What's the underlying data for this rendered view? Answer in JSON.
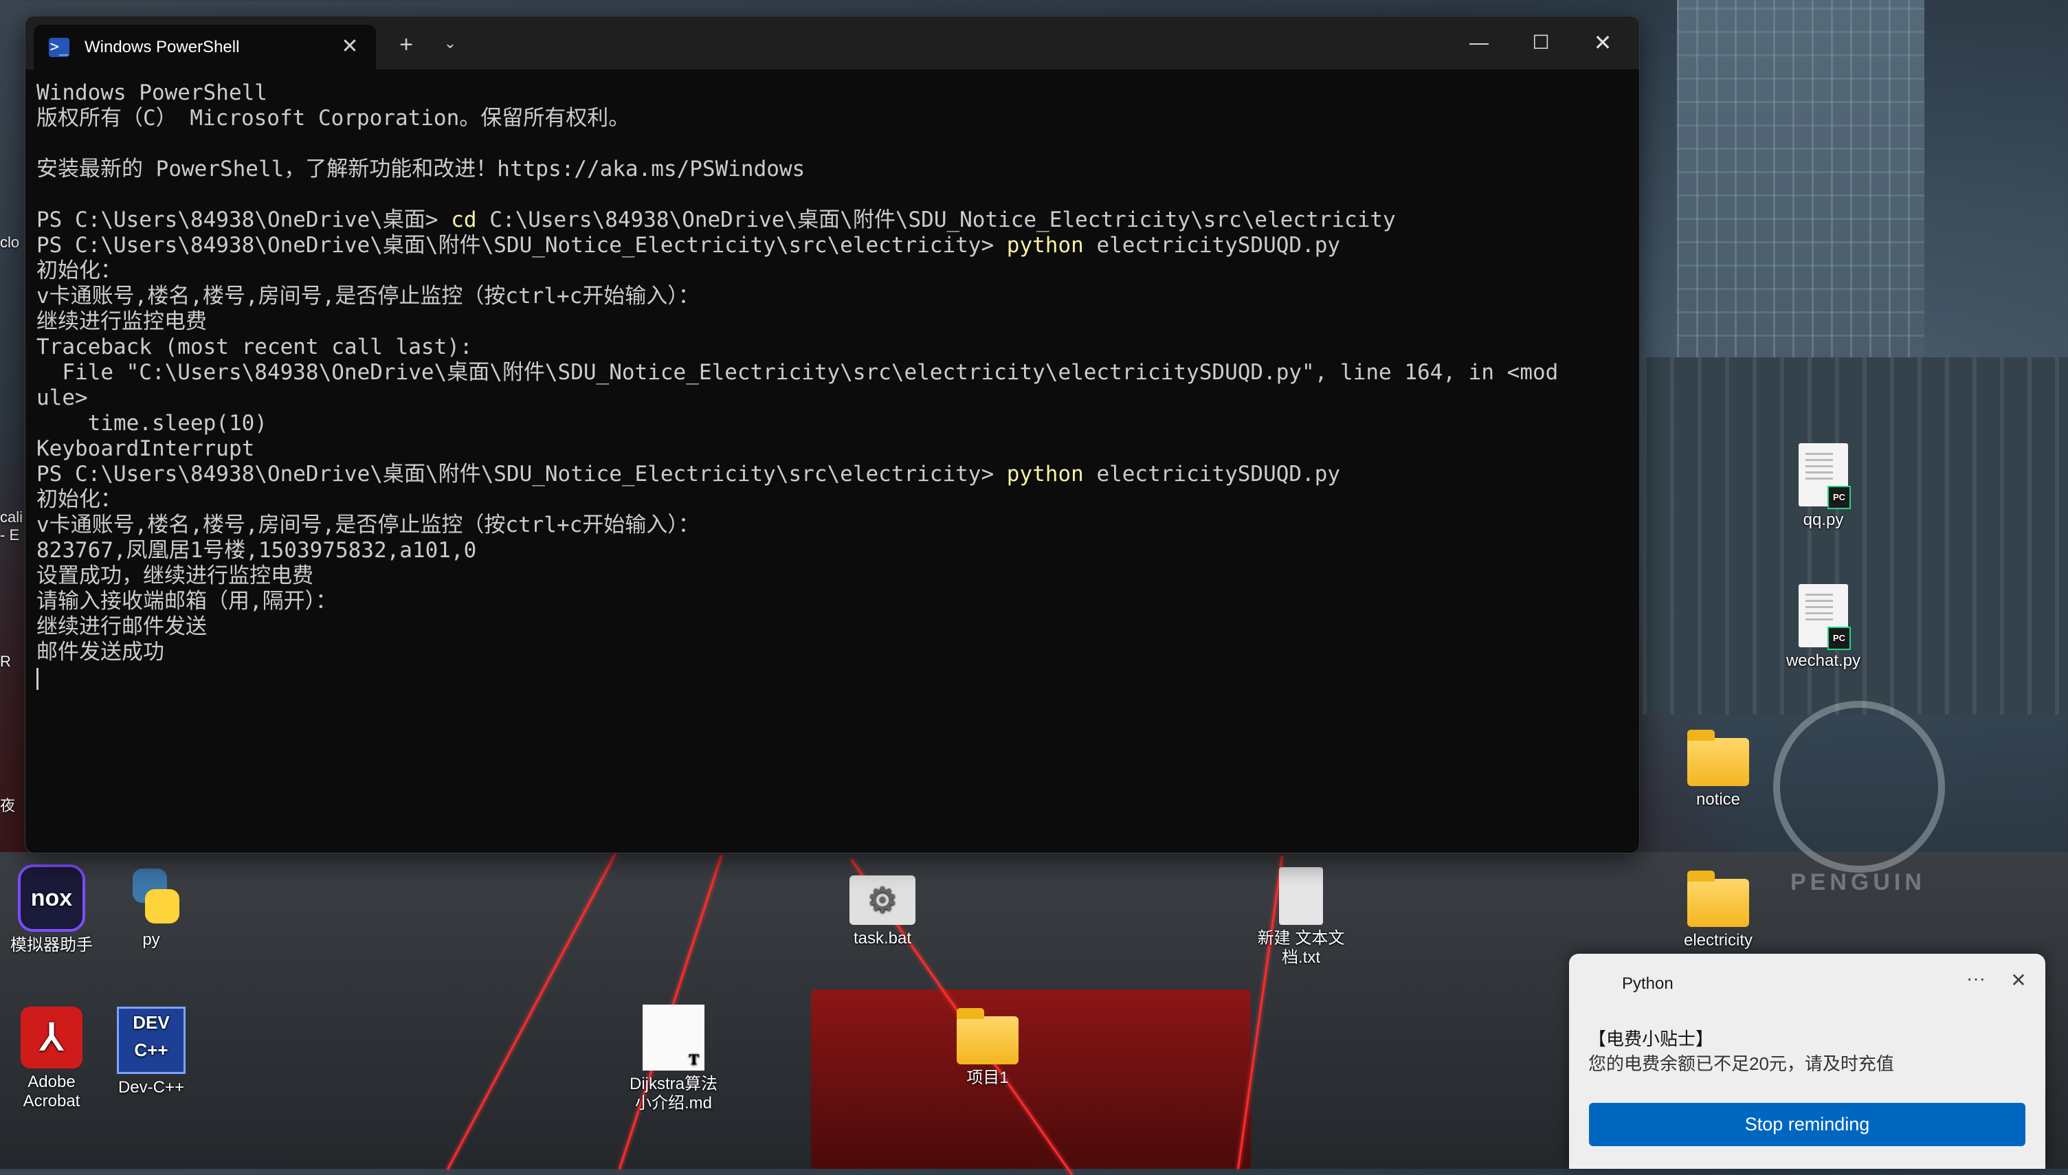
{
  "terminal": {
    "tab_title": "Windows PowerShell",
    "tab_icon": "powershell-icon",
    "lines": [
      [
        {
          "t": "Windows PowerShell"
        }
      ],
      [
        {
          "t": "版权所有（C） Microsoft Corporation。保留所有权利。"
        }
      ],
      [
        {
          "t": ""
        }
      ],
      [
        {
          "t": "安装最新的 PowerShell，了解新功能和改进！https://aka.ms/PSWindows"
        }
      ],
      [
        {
          "t": ""
        }
      ],
      [
        {
          "t": "PS C:\\Users\\84938\\OneDrive\\桌面> "
        },
        {
          "t": "cd",
          "c": "cmd"
        },
        {
          "t": " C:\\Users\\84938\\OneDrive\\桌面\\附件\\SDU_Notice_Electricity\\src\\electricity"
        }
      ],
      [
        {
          "t": "PS C:\\Users\\84938\\OneDrive\\桌面\\附件\\SDU_Notice_Electricity\\src\\electricity> "
        },
        {
          "t": "python",
          "c": "cmd"
        },
        {
          "t": " electricitySDUQD.py"
        }
      ],
      [
        {
          "t": "初始化："
        }
      ],
      [
        {
          "t": "v卡通账号,楼名,楼号,房间号,是否停止监控（按ctrl+c开始输入）："
        }
      ],
      [
        {
          "t": "继续进行监控电费"
        }
      ],
      [
        {
          "t": "Traceback (most recent call last):"
        }
      ],
      [
        {
          "t": "  File \"C:\\Users\\84938\\OneDrive\\桌面\\附件\\SDU_Notice_Electricity\\src\\electricity\\electricitySDUQD.py\", line 164, in <mod"
        }
      ],
      [
        {
          "t": "ule>"
        }
      ],
      [
        {
          "t": "    time.sleep(10)"
        }
      ],
      [
        {
          "t": "KeyboardInterrupt"
        }
      ],
      [
        {
          "t": "PS C:\\Users\\84938\\OneDrive\\桌面\\附件\\SDU_Notice_Electricity\\src\\electricity> "
        },
        {
          "t": "python",
          "c": "cmd"
        },
        {
          "t": " electricitySDUQD.py"
        }
      ],
      [
        {
          "t": "初始化："
        }
      ],
      [
        {
          "t": "v卡通账号,楼名,楼号,房间号,是否停止监控（按ctrl+c开始输入）："
        }
      ],
      [
        {
          "t": "823767,凤凰居1号楼,1503975832,a101,0"
        }
      ],
      [
        {
          "t": "设置成功，继续进行监控电费"
        }
      ],
      [
        {
          "t": "请输入接收端邮箱（用,隔开）："
        }
      ],
      [
        {
          "t": "继续进行邮件发送"
        }
      ],
      [
        {
          "t": "邮件发送成功"
        }
      ]
    ]
  },
  "desktop": {
    "qq_py": "qq.py",
    "wechat_py": "wechat.py",
    "notice": "notice",
    "electricity": "electricity",
    "nox": "模拟器助手",
    "py": "py",
    "task_bat": "task.bat",
    "new_txt": "新建 文本文\n档.txt",
    "acrobat": "Adobe\nAcrobat",
    "devcpp": "Dev-C++",
    "dijkstra": "Dijkstra算法\n小介绍.md",
    "project1": "项目1",
    "edge_clo": "clo",
    "edge_cali": "cali\n- E",
    "edge_r": "R",
    "edge_ye": "夜"
  },
  "toast": {
    "app": "Python",
    "title": "【电费小贴士】",
    "body": "您的电费余额已不足20元，请及时充值",
    "button": "Stop reminding"
  },
  "colors": {
    "terminal_bg": "#0c0c0c",
    "terminal_text": "#cccccc",
    "command_highlight": "#f9f1a5",
    "toast_button": "#0067c0"
  }
}
